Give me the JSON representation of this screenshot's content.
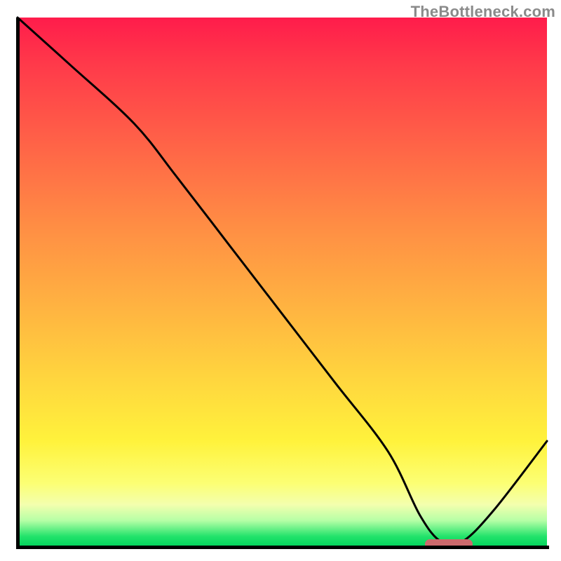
{
  "watermark": "TheBottleneck.com",
  "chart_data": {
    "type": "line",
    "title": "",
    "xlabel": "",
    "ylabel": "",
    "xlim": [
      0,
      100
    ],
    "ylim": [
      0,
      100
    ],
    "grid": false,
    "legend": false,
    "gradient_stops": [
      {
        "pos": 0,
        "color": "#ff1c4b"
      },
      {
        "pos": 25,
        "color": "#ff6647"
      },
      {
        "pos": 55,
        "color": "#ffb441"
      },
      {
        "pos": 80,
        "color": "#fff23c"
      },
      {
        "pos": 92,
        "color": "#f3ffae"
      },
      {
        "pos": 100,
        "color": "#00d25b"
      }
    ],
    "series": [
      {
        "name": "bottleneck-curve",
        "x": [
          0,
          10,
          22,
          30,
          40,
          50,
          60,
          70,
          76,
          80,
          84,
          90,
          100
        ],
        "y": [
          100,
          91,
          80,
          70,
          57,
          44,
          31,
          18,
          6,
          1,
          1,
          7,
          20
        ]
      }
    ],
    "optimal_marker": {
      "x_start": 77,
      "x_end": 86,
      "y": 0.5,
      "color": "#cd6a6d"
    }
  }
}
